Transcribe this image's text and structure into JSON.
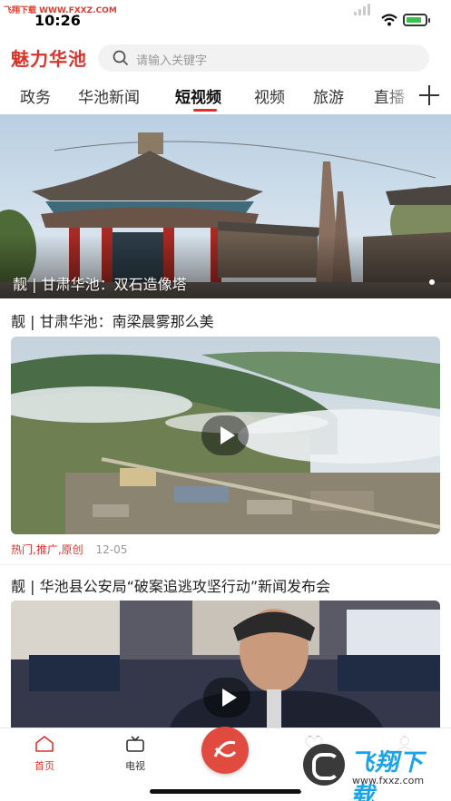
{
  "status_bar": {
    "watermark": "飞翔下载 WWW.FXXZ.COM",
    "time": "10:26"
  },
  "header": {
    "logo": "魅力华池",
    "search_placeholder": "请输入关键字"
  },
  "tabs": [
    "政务",
    "华池新闻",
    "短视频",
    "视频",
    "旅游",
    "直播"
  ],
  "active_tab": "短视频",
  "hero": {
    "caption": "靓 | 甘肃华池：双石造像塔"
  },
  "cards": [
    {
      "title": "靓 | 甘肃华池：南梁晨雾那么美",
      "tags": "热门,推广,原创",
      "date": "12-05"
    },
    {
      "title": "靓 | 华池县公安局“破案追逃攻坚行动”新闻发布会"
    }
  ],
  "bottom_nav": {
    "home": "首页",
    "tv": "电视"
  },
  "watermark": {
    "brand": "飞翔下载",
    "url": "www.fxxz.com"
  },
  "colors": {
    "accent": "#d9342b",
    "tab_text": "#333333"
  }
}
